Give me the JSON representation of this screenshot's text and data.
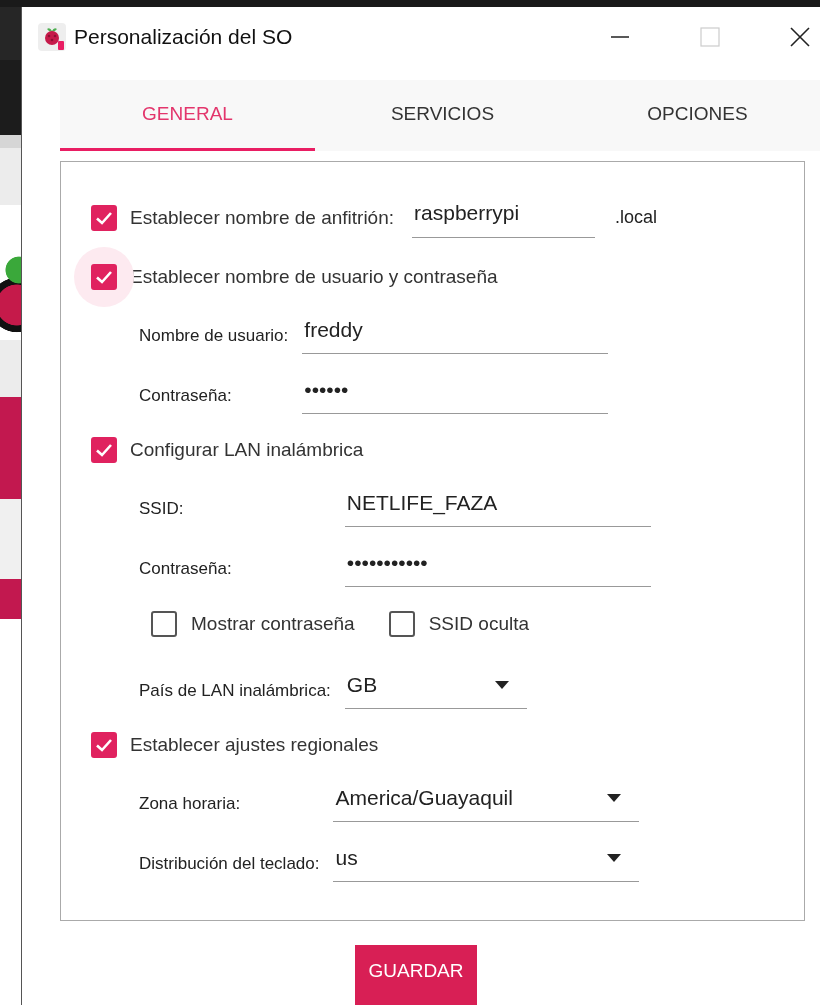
{
  "window": {
    "title": "Personalización del SO"
  },
  "tabs": [
    {
      "label": "GENERAL",
      "selected": true
    },
    {
      "label": "SERVICIOS",
      "selected": false
    },
    {
      "label": "OPCIONES",
      "selected": false
    }
  ],
  "sections": [
    {
      "label": "Establecer nombre de anfitrión:",
      "checked": true,
      "focused": false,
      "field": {
        "value": "raspberrypi"
      },
      "suffix": ".local"
    },
    {
      "label": "Establecer nombre de usuario y contraseña",
      "checked": true,
      "focused": true,
      "children": [
        {
          "kind": "text",
          "label": "Nombre de usuario:",
          "value": "freddy"
        },
        {
          "kind": "password",
          "label": "Contraseña:",
          "value": "••••••"
        }
      ]
    },
    {
      "label": "Configurar LAN inalámbrica",
      "checked": true,
      "focused": false,
      "children": [
        {
          "kind": "text",
          "label": "SSID:",
          "value": "NETLIFE_FAZA"
        },
        {
          "kind": "password",
          "label": "Contraseña:",
          "value": "•••••••••••"
        },
        {
          "kind": "options",
          "items": [
            {
              "label": "Mostrar contraseña",
              "checked": false
            },
            {
              "label": "SSID oculta",
              "checked": false
            }
          ]
        },
        {
          "kind": "select",
          "label": "País de LAN inalámbrica:",
          "value": "GB"
        }
      ]
    },
    {
      "label": "Establecer ajustes regionales",
      "checked": true,
      "focused": false,
      "children": [
        {
          "kind": "select",
          "label": "Zona horaria:",
          "value": "America/Guayaquil"
        },
        {
          "kind": "select",
          "label": "Distribución del teclado:",
          "value": "us"
        }
      ]
    }
  ],
  "save_button": "GUARDAR"
}
